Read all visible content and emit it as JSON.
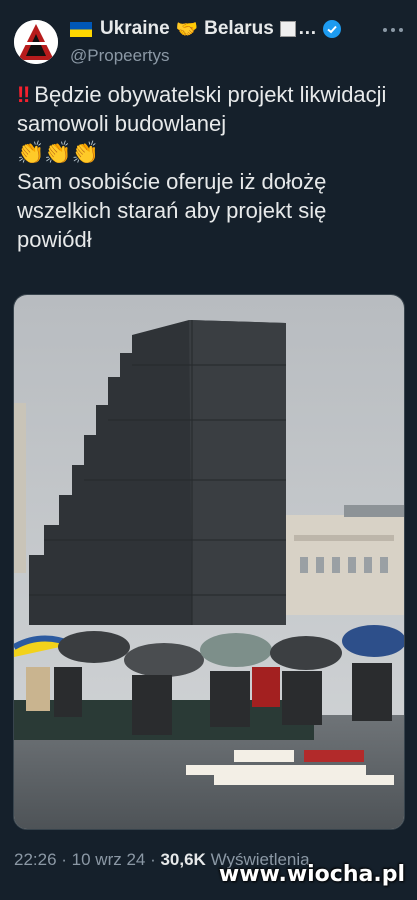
{
  "author": {
    "display_name_left": "Ukraine",
    "display_name_right": "Belarus",
    "ellipsis": "…",
    "handle": "@Propeertys",
    "verified": true,
    "icons": [
      "ukraine-flag-icon",
      "handshake-icon",
      "white-square-icon",
      "verified-badge-icon"
    ]
  },
  "tweet": {
    "line1": "Będzie obywatelski projekt likwidacji samowoli budowlanej",
    "claps": "👏👏👏",
    "line2": "Sam osobiście oferuje iż dołożę wszelkich starań aby projekt się powiódł"
  },
  "meta": {
    "time": "22:26",
    "sep1": " · ",
    "date": "10 wrz 24",
    "sep2": " · ",
    "views": "30,6K",
    "views_label": "Wyświetlenia"
  },
  "watermark": "www.wiocha.pl",
  "colors": {
    "background": "#15202b",
    "text": "#e7e9ea",
    "secondary": "#8b98a5",
    "accent": "#1d9bf0"
  }
}
